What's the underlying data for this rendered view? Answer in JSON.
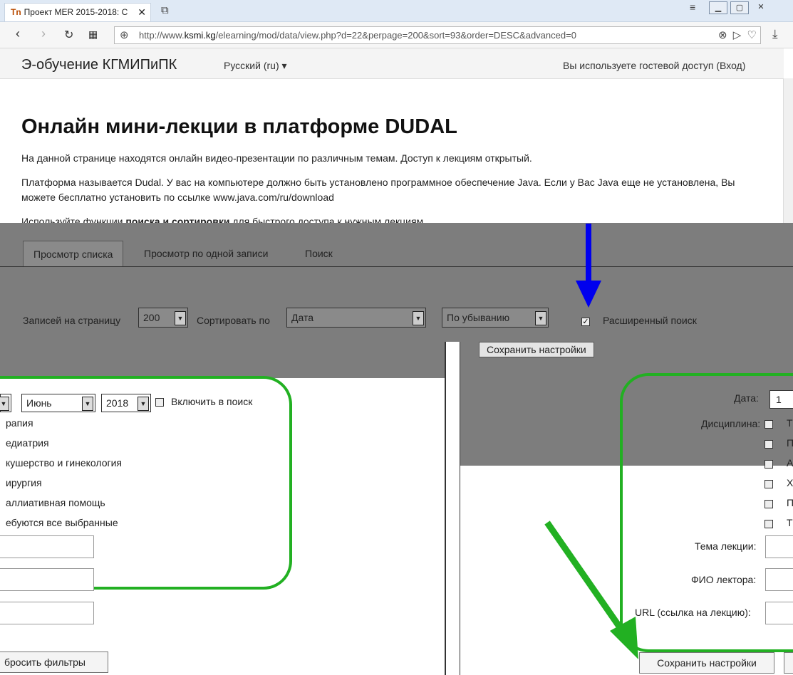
{
  "browser": {
    "tab_title": "Проект MER 2015-2018: С",
    "favicon": "Tn",
    "url_prefix": "http://www.",
    "url_domain": "ksmi.kg",
    "url_rest": "/elearning/mod/data/view.php?d=22&perpage=200&sort=93&order=DESC&advanced=0"
  },
  "site": {
    "name": "Э-обучение КГМИПиПК",
    "language": "Русский (ru) ▾",
    "guest_notice": "Вы используете гостевой доступ (Вход)"
  },
  "page": {
    "title": "Онлайн мини-лекции в платформе DUDAL",
    "p1": "На данной странице находятся онлайн видео-презентации по различным темам. Доступ к лекциям открытый.",
    "p2": "Платформа называется Dudal. У вас на компьютере должно быть установлено программное обеспечение Java. Если у Вас Java еще не установлена, Вы можете бесплатно установить по ссылке www.java.com/ru/download",
    "p3_before": "Используйте функции ",
    "p3_bold": "поиска и сортировки ",
    "p3_after": "для быстрого доступа к нужным лекциям."
  },
  "tabs": {
    "list_view": "Просмотр списка",
    "single_view": "Просмотр по одной записи",
    "search": "Поиск"
  },
  "controls": {
    "per_page_label": "Записей на страницу",
    "per_page_value": "200",
    "sort_label": "Сортировать по",
    "sort_field": "Дата",
    "sort_order": "По убыванию",
    "advanced_label": "Расширенный поиск",
    "advanced_checked": "✓",
    "save_settings": "Сохранить настройки"
  },
  "left_panel": {
    "month": "Июнь",
    "year": "2018",
    "include_label": "Включить в поиск",
    "items": [
      "рапия",
      "едиатрия",
      "кушерство и гинекология",
      "ирургия",
      "аллиативная помощь",
      "ебуются все выбранные"
    ],
    "reset_button": "бросить фильтры"
  },
  "right_panel": {
    "date_label": "Дата:",
    "date_value": "1",
    "discipline_label": "Дисциплина:",
    "discipline_letters": [
      "Т",
      "П",
      "А",
      "Х",
      "П",
      "Т"
    ],
    "topic_label": "Тема лекции:",
    "lecturer_label": "ФИО лектора:",
    "url_label": "URL (ссылка на лекцию):",
    "save_button": "Сохранить настройки"
  },
  "colors": {
    "highlight_green": "#22b022",
    "arrow_blue": "#0000ee",
    "overlay_grey": "#7d7d7d"
  }
}
